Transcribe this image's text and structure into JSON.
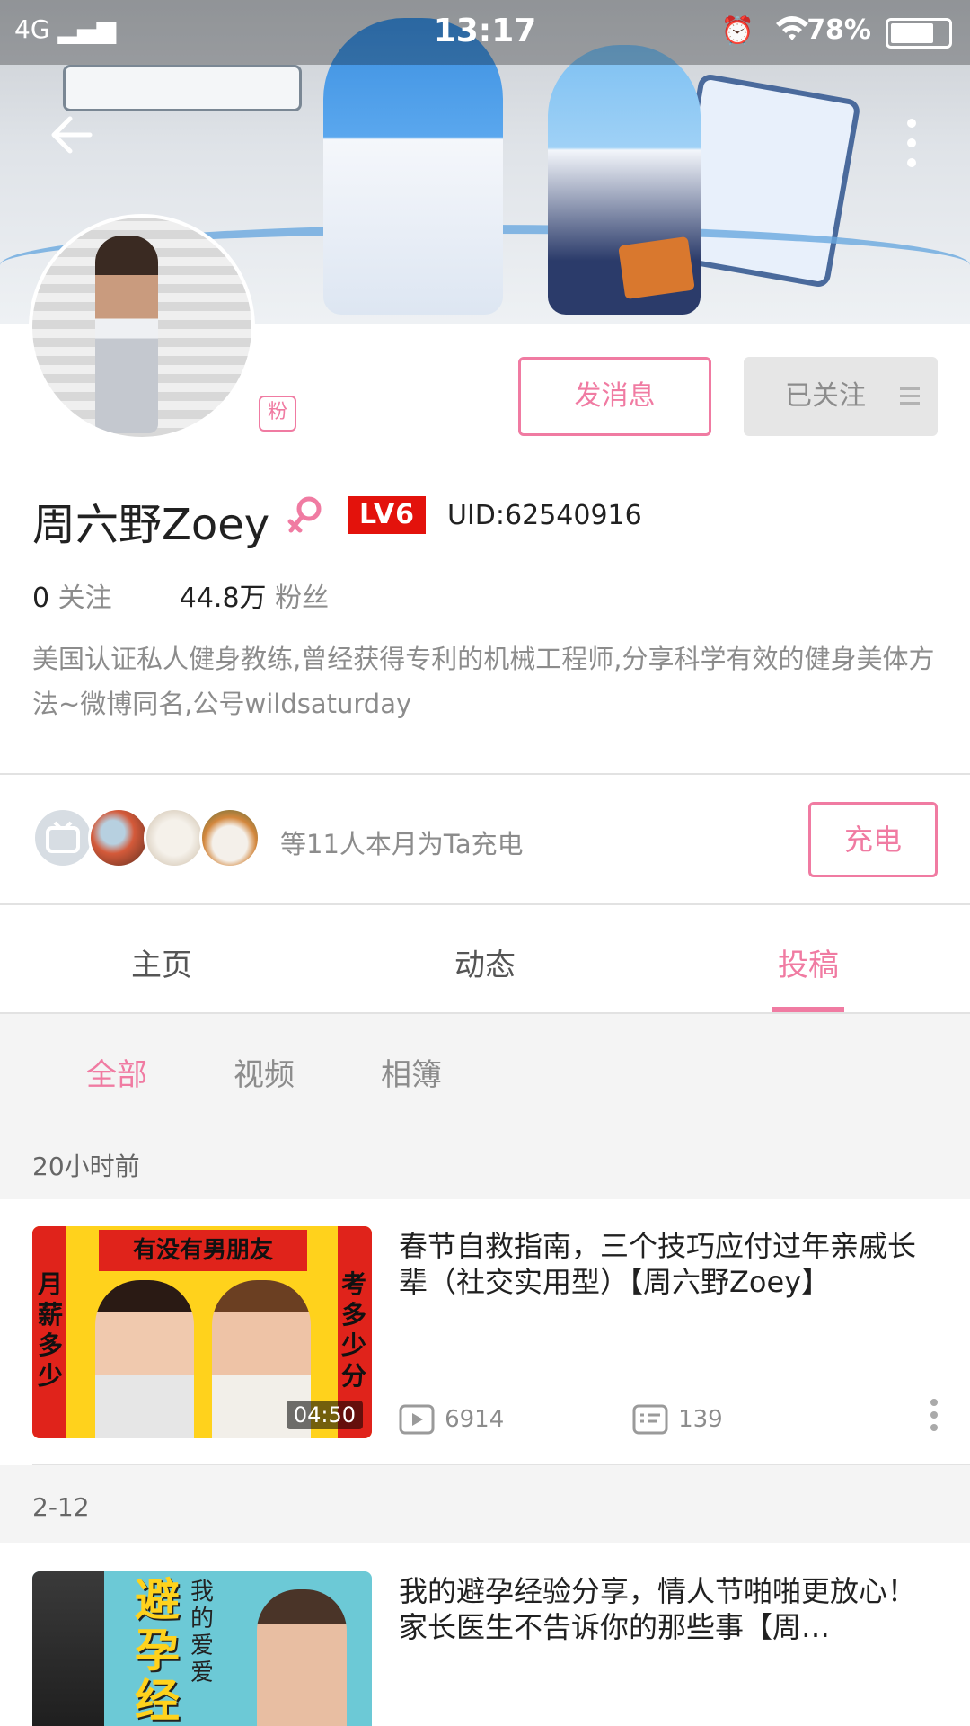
{
  "status_bar": {
    "network": "4G",
    "time": "13:17",
    "battery_text": "78%"
  },
  "profile": {
    "fan_badge": "粉",
    "message_button": "发消息",
    "follow_button": "已关注",
    "username": "周六野Zoey",
    "level": "LV6",
    "uid": "UID:62540916",
    "following_count": "0",
    "following_label": "关注",
    "followers_count": "44.8万",
    "followers_label": "粉丝",
    "bio": "美国认证私人健身教练,曾经获得专利的机械工程师,分享科学有效的健身美体方法~微博同名,公号wildsaturday"
  },
  "charge": {
    "text": "等11人本月为Ta充电",
    "button": "充电"
  },
  "tabs": [
    "主页",
    "动态",
    "投稿"
  ],
  "filters": [
    "全部",
    "视频",
    "相簿"
  ],
  "videos": [
    {
      "date": "20小时前",
      "title": "春节自救指南，三个技巧应付过年亲戚长辈（社交实用型）【周六野Zoey】",
      "duration": "04:50",
      "plays": "6914",
      "comments": "139",
      "thumb_banner": "有没有男朋友",
      "thumb_left": "月薪多少",
      "thumb_right": "考多少分"
    },
    {
      "date": "2-12",
      "title": "我的避孕经验分享，情人节啪啪更放心！家长医生不告诉你的那些事【周…",
      "thumb_big": "避孕经",
      "thumb_small": "我的爱爱"
    }
  ],
  "colors": {
    "accent": "#f07ba2",
    "level_badge": "#e3120c"
  }
}
